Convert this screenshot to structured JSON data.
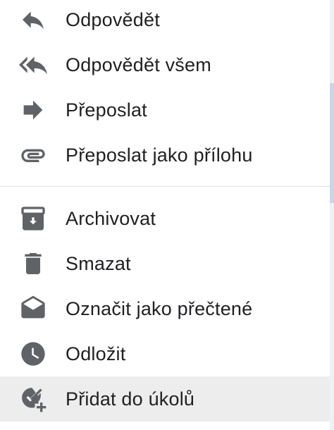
{
  "menu": {
    "reply": {
      "label": "Odpovědět",
      "icon": "reply-icon"
    },
    "reply_all": {
      "label": "Odpovědět všem",
      "icon": "reply-all-icon"
    },
    "forward": {
      "label": "Přeposlat",
      "icon": "forward-icon"
    },
    "forward_attachment": {
      "label": "Přeposlat jako přílohu",
      "icon": "attachment-icon"
    },
    "archive": {
      "label": "Archivovat",
      "icon": "archive-icon"
    },
    "delete": {
      "label": "Smazat",
      "icon": "trash-icon"
    },
    "mark_read": {
      "label": "Označit jako přečtené",
      "icon": "open-envelope-icon"
    },
    "snooze": {
      "label": "Odložit",
      "icon": "clock-icon"
    },
    "add_task": {
      "label": "Přidat do úkolů",
      "icon": "add-task-icon"
    }
  },
  "colors": {
    "icon": "#5f6368",
    "text": "#202124",
    "hover_bg": "#ededed",
    "divider": "#e0e0e0"
  }
}
